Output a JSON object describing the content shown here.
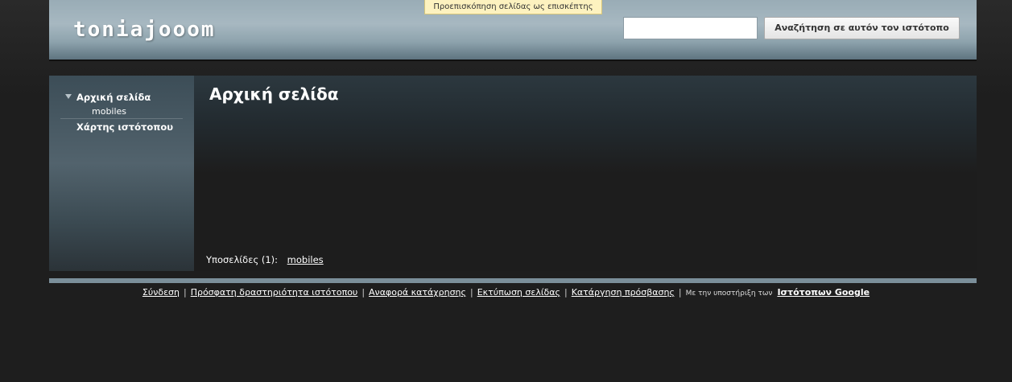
{
  "preview_banner": "Προεπισκόπηση σελίδας ως επισκέπτης",
  "header": {
    "site_title": "toniajooom",
    "search_placeholder": "",
    "search_button_label": "Αναζήτηση σε αυτόν τον ιστότοπο"
  },
  "sidebar": {
    "items": [
      {
        "label": "Αρχική σελίδα"
      },
      {
        "label": "mobiles"
      },
      {
        "label": "Χάρτης ιστότοπου"
      }
    ]
  },
  "main": {
    "page_title": "Αρχική σελίδα",
    "subpages_label": "Υποσελίδες (1):",
    "subpages": [
      "mobiles"
    ]
  },
  "footer": {
    "links": [
      "Σύνδεση",
      "Πρόσφατη δραστηριότητα ιστότοπου",
      "Αναφορά κατάχρησης",
      "Εκτύπωση σελίδας",
      "Κατάργηση πρόσβασης"
    ],
    "powered_by": "Με την υποστήριξη των",
    "google_sites": "Ιστότοπων Google"
  },
  "colors": {
    "header_bg": "#a7b8c1",
    "sidebar_bg": "#52636d",
    "page_bg": "#1e1e1e",
    "banner_bg": "#fdf2bf"
  }
}
